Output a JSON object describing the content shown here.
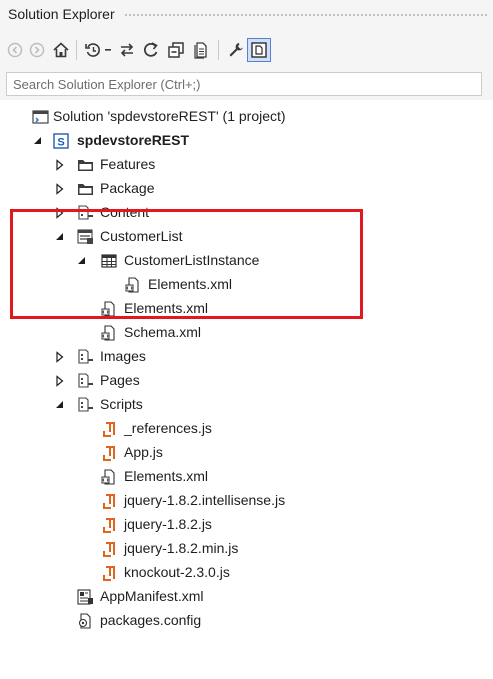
{
  "panel": {
    "title": "Solution Explorer"
  },
  "search": {
    "placeholder": "Search Solution Explorer (Ctrl+;)"
  },
  "toolbar": {
    "buttons": [
      "back",
      "forward",
      "home",
      "history",
      "sync",
      "refresh",
      "collapse-all",
      "show-all-files",
      "properties",
      "preview"
    ]
  },
  "tree": {
    "items": [
      {
        "label": "Solution 'spdevstoreREST' (1 project)",
        "icon": "solution-icon"
      },
      {
        "label": "spdevstoreREST",
        "icon": "sharepoint-project-icon",
        "expanded": true
      },
      {
        "label": "Features",
        "icon": "folder-icon",
        "expanded": false
      },
      {
        "label": "Package",
        "icon": "folder-icon",
        "expanded": false
      },
      {
        "label": "Content",
        "icon": "module-icon",
        "expanded": false
      },
      {
        "label": "CustomerList",
        "icon": "list-icon",
        "expanded": true
      },
      {
        "label": "CustomerListInstance",
        "icon": "list-instance-icon",
        "expanded": true
      },
      {
        "label": "Elements.xml",
        "icon": "xml-file-icon"
      },
      {
        "label": "Elements.xml",
        "icon": "xml-file-icon"
      },
      {
        "label": "Schema.xml",
        "icon": "xml-file-icon"
      },
      {
        "label": "Images",
        "icon": "module-icon",
        "expanded": false
      },
      {
        "label": "Pages",
        "icon": "module-icon",
        "expanded": false
      },
      {
        "label": "Scripts",
        "icon": "module-icon",
        "expanded": true
      },
      {
        "label": "_references.js",
        "icon": "js-file-icon"
      },
      {
        "label": "App.js",
        "icon": "js-file-icon"
      },
      {
        "label": "Elements.xml",
        "icon": "xml-file-icon"
      },
      {
        "label": "jquery-1.8.2.intellisense.js",
        "icon": "js-file-icon"
      },
      {
        "label": "jquery-1.8.2.js",
        "icon": "js-file-icon"
      },
      {
        "label": "jquery-1.8.2.min.js",
        "icon": "js-file-icon"
      },
      {
        "label": "knockout-2.3.0.js",
        "icon": "js-file-icon"
      },
      {
        "label": "AppManifest.xml",
        "icon": "app-manifest-icon"
      },
      {
        "label": "packages.config",
        "icon": "config-file-icon"
      }
    ]
  },
  "colors": {
    "highlight": "#e0191f",
    "js": "#e0651b",
    "project": "#1e5bb5"
  }
}
